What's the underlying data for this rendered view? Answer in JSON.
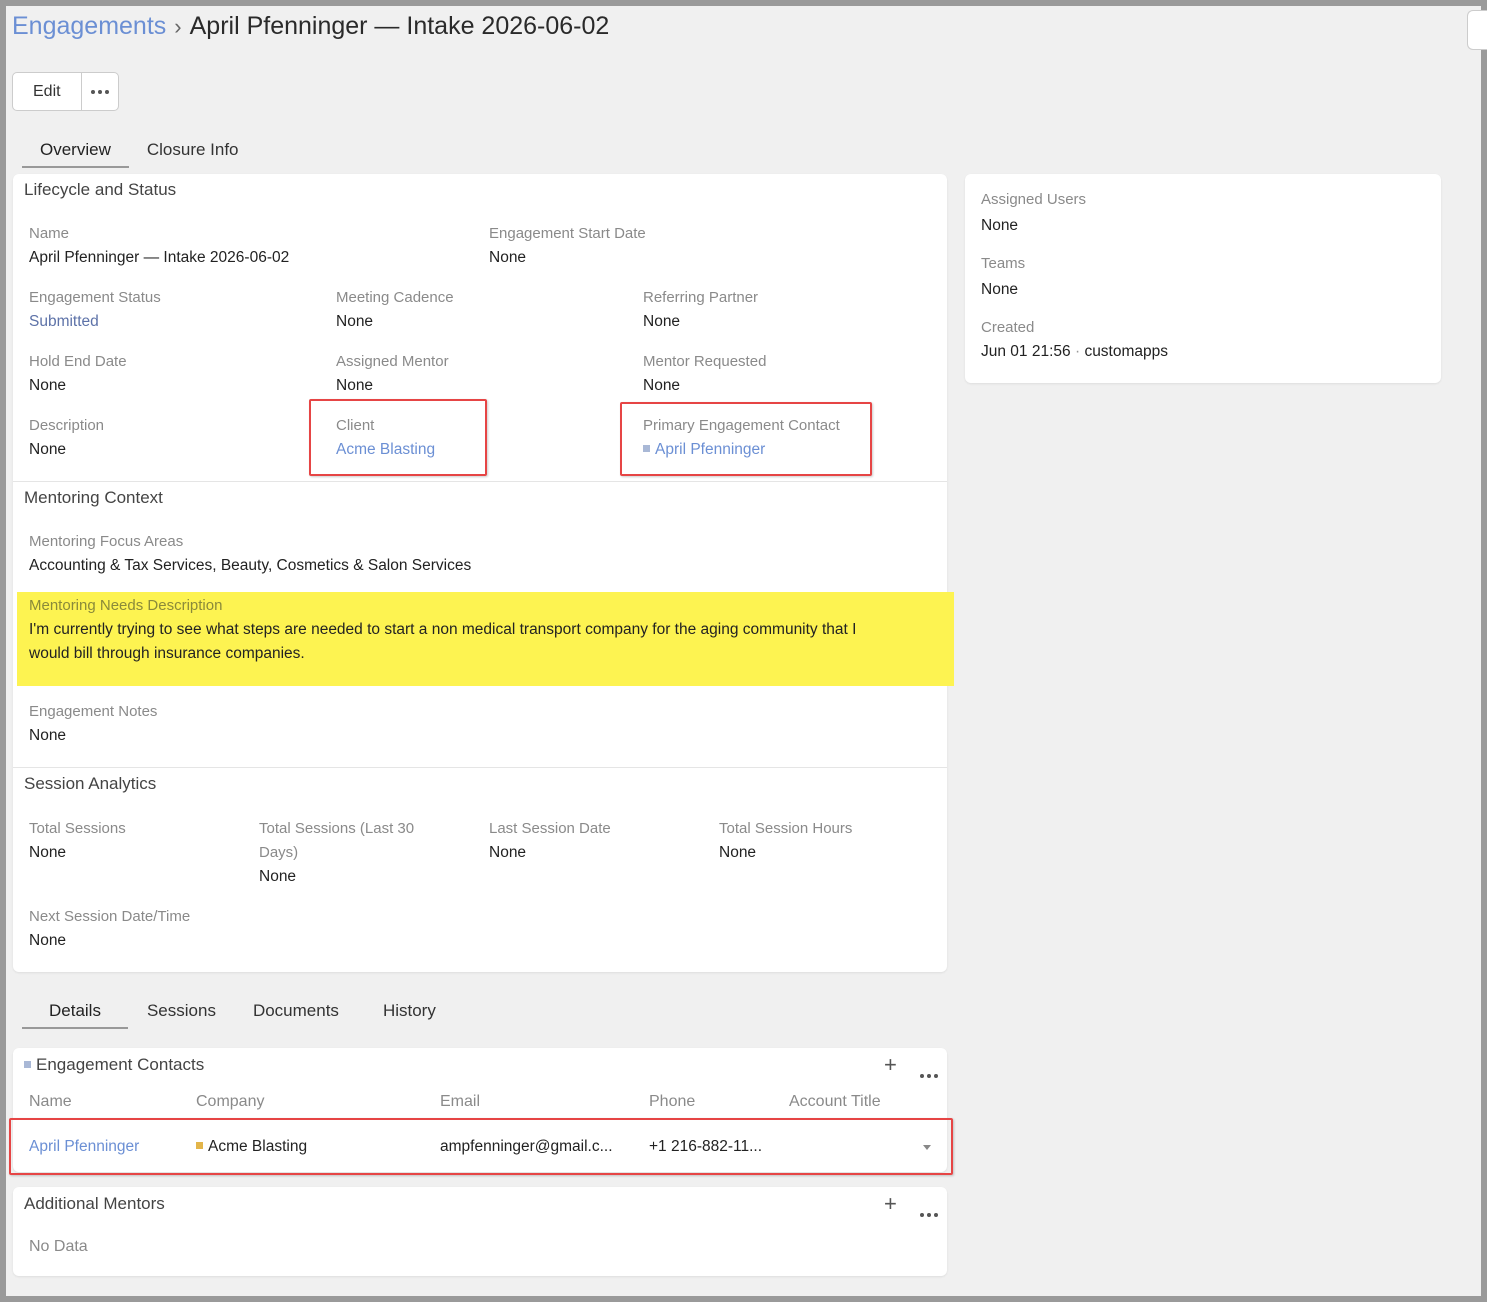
{
  "breadcrumb": {
    "parent": "Engagements",
    "separator": "›",
    "title": "April Pfenninger — Intake 2026-06-02"
  },
  "toolbar": {
    "edit_label": "Edit"
  },
  "tabs_top": [
    "Overview",
    "Closure Info"
  ],
  "lifecycle": {
    "title": "Lifecycle and Status",
    "name_label": "Name",
    "name_value": "April Pfenninger — Intake 2026-06-02",
    "start_label": "Engagement Start Date",
    "start_value": "None",
    "status_label": "Engagement Status",
    "status_value": "Submitted",
    "cadence_label": "Meeting Cadence",
    "cadence_value": "None",
    "referring_label": "Referring Partner",
    "referring_value": "None",
    "hold_label": "Hold End Date",
    "hold_value": "None",
    "mentor_label": "Assigned Mentor",
    "mentor_value": "None",
    "mentor_req_label": "Mentor Requested",
    "mentor_req_value": "None",
    "desc_label": "Description",
    "desc_value": "None",
    "client_label": "Client",
    "client_value": "Acme Blasting",
    "primary_label": "Primary Engagement Contact",
    "primary_value": "April Pfenninger"
  },
  "mentoring": {
    "title": "Mentoring Context",
    "focus_label": "Mentoring Focus Areas",
    "focus_value": "Accounting & Tax Services, Beauty, Cosmetics & Salon Services",
    "needs_label": "Mentoring Needs Description",
    "needs_line1": "I'm currently trying to see what steps are needed to start a non medical transport company for the aging community that I",
    "needs_line2": "would bill through insurance companies.",
    "notes_label": "Engagement Notes",
    "notes_value": "None"
  },
  "analytics": {
    "title": "Session Analytics",
    "total_label": "Total Sessions",
    "total_value": "None",
    "last30_label_1": "Total Sessions (Last 30",
    "last30_label_2": "Days)",
    "last30_value": "None",
    "last_date_label": "Last Session Date",
    "last_date_value": "None",
    "hours_label": "Total Session Hours",
    "hours_value": "None",
    "next_label": "Next Session Date/Time",
    "next_value": "None"
  },
  "side": {
    "users_label": "Assigned Users",
    "users_value": "None",
    "teams_label": "Teams",
    "teams_value": "None",
    "created_label": "Created",
    "created_date": "Jun 01 21:56",
    "created_dot": "·",
    "created_by": "customapps"
  },
  "tabs_bottom": [
    "Details",
    "Sessions",
    "Documents",
    "History"
  ],
  "contacts": {
    "title": "Engagement Contacts",
    "columns": [
      "Name",
      "Company",
      "Email",
      "Phone",
      "Account Title"
    ],
    "row": {
      "name": "April Pfenninger",
      "company": "Acme Blasting",
      "email": "ampfenninger@gmail.c...",
      "phone": "+1 216-882-11...",
      "account_title": ""
    }
  },
  "mentors": {
    "title": "Additional Mentors",
    "empty": "No Data"
  },
  "colors": {
    "link": "#6b8fd4",
    "highlight": "#fdf351",
    "annotation_box": "#e64545",
    "contact_marker": "#a9b8d6",
    "company_marker": "#e3b54a"
  },
  "icons": [
    "chevron-right-icon",
    "more-horizontal-icon",
    "plus-icon",
    "caret-down-icon"
  ]
}
